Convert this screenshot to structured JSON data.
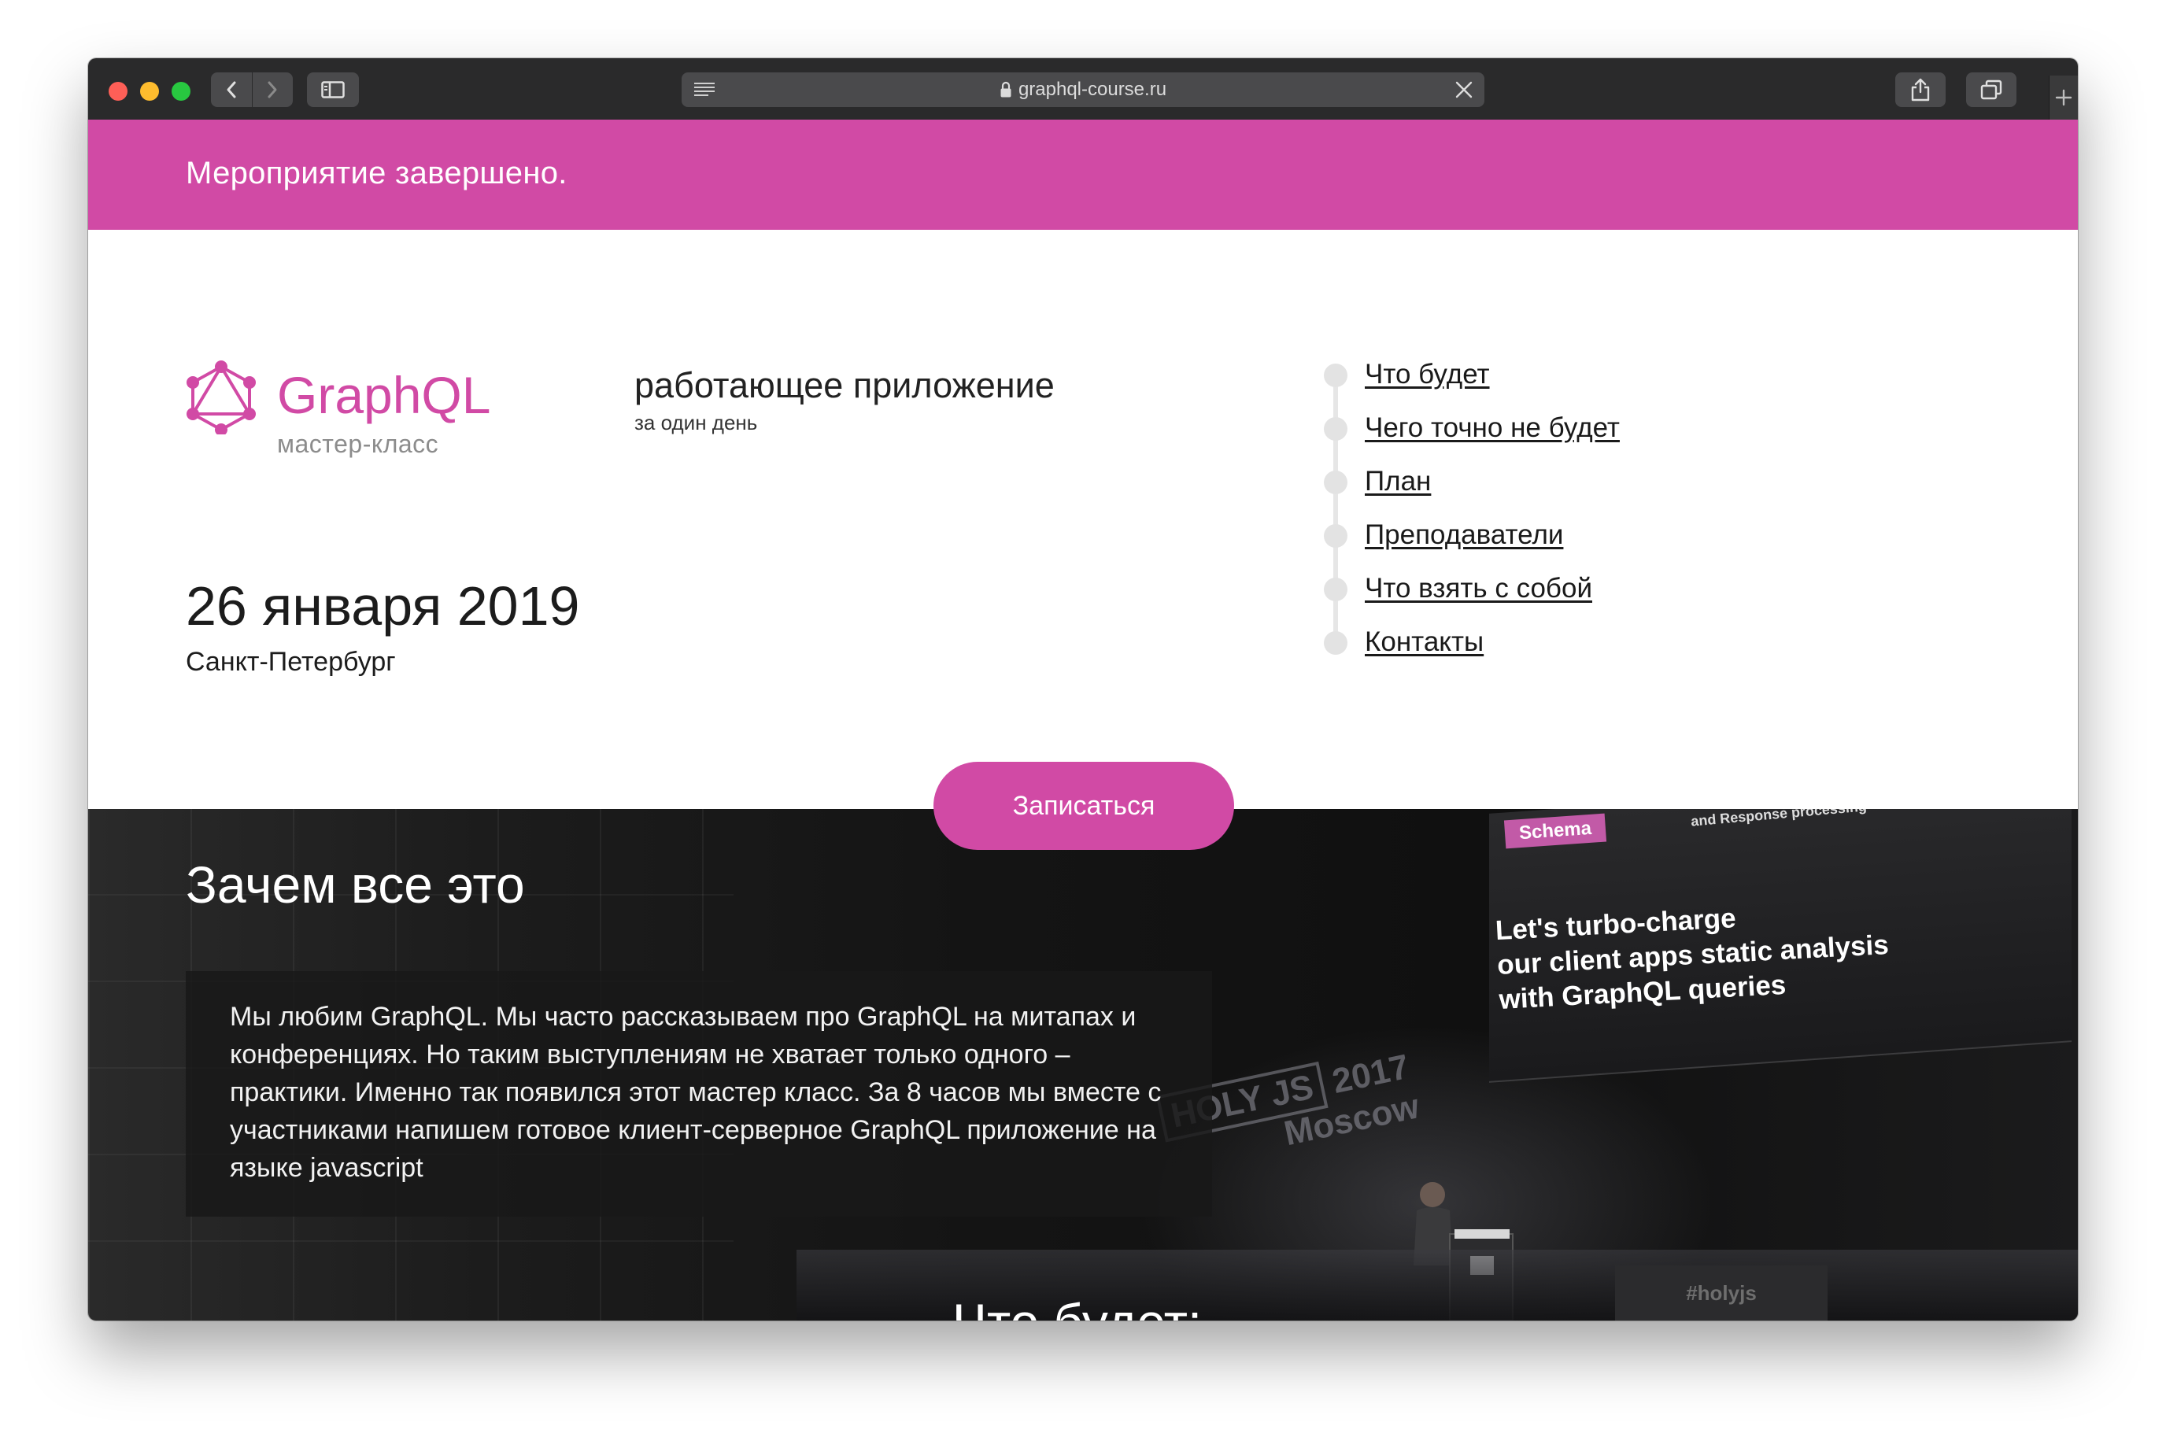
{
  "browser": {
    "url": "graphql-course.ru"
  },
  "banner": {
    "text": "Мероприятие завершено."
  },
  "logo": {
    "title": "GraphQL",
    "subtitle": "мастер-класс"
  },
  "tagline": {
    "main": "работающее приложение",
    "sub": "за один день"
  },
  "event": {
    "date": "26 января 2019",
    "city": "Санкт-Петербург"
  },
  "menu": {
    "items": [
      {
        "label": "Что будет"
      },
      {
        "label": "Чего точно не будет"
      },
      {
        "label": "План"
      },
      {
        "label": "Преподаватели"
      },
      {
        "label": "Что взять с собой"
      },
      {
        "label": "Контакты"
      }
    ]
  },
  "cta": {
    "label": "Записаться"
  },
  "about": {
    "title": "Зачем все это",
    "text": "Мы любим GraphQL. Мы часто рассказываем про GraphQL на митапах и конференциях. Но таким выступлениям не хватает только одного – практики. Именно так появился этот мастер класс. За 8 часов мы вместе с участниками напишем готовое клиент-серверное GraphQL приложение на языке javascript"
  },
  "photo": {
    "schema_label": "Schema",
    "response_label": "and Response processing",
    "slide_lines": [
      "Let's turbo-charge",
      "our client apps static analysis",
      "with GraphQL queries"
    ],
    "stage_brand": "HOLY JS",
    "stage_year": "2017",
    "stage_city": "Moscow",
    "hashtag": "#holyjs"
  },
  "next_section": {
    "title": "Что будет:"
  },
  "colors": {
    "accent": "#d14aa5",
    "toolbar": "#2a2a2b",
    "dark_bg": "#141414"
  }
}
